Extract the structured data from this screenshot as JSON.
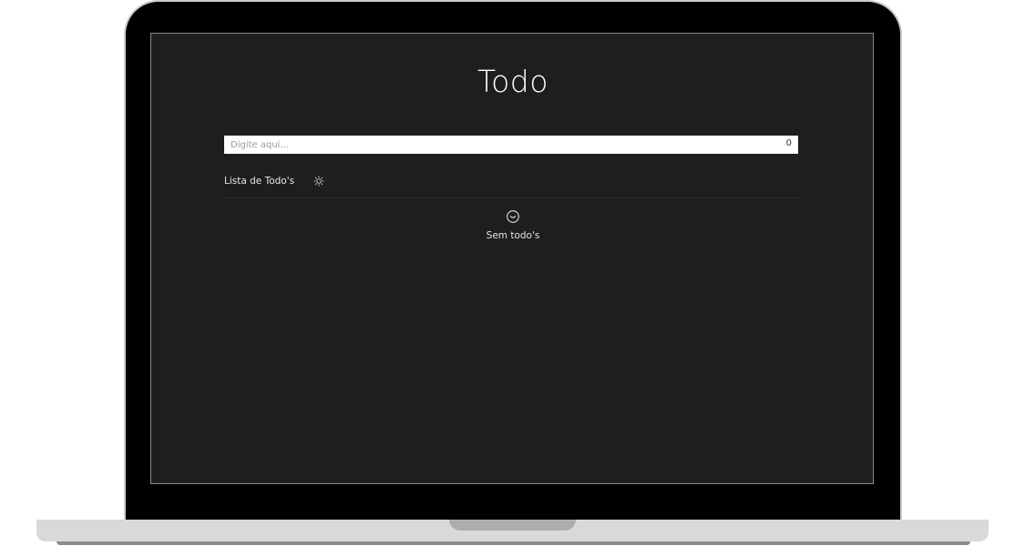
{
  "app": {
    "title": "Todo"
  },
  "input": {
    "placeholder": "Digite aqui...",
    "value": "",
    "char_count": "0"
  },
  "list": {
    "header_label": "Lista de Todo's",
    "toggle_icon": "sun-icon",
    "empty_icon": "smiley-icon",
    "empty_message": "Sem todo's",
    "items": []
  },
  "theme": {
    "screen_bg": "#1e1e1e",
    "text": "#ffffff",
    "frame": "#000000"
  }
}
